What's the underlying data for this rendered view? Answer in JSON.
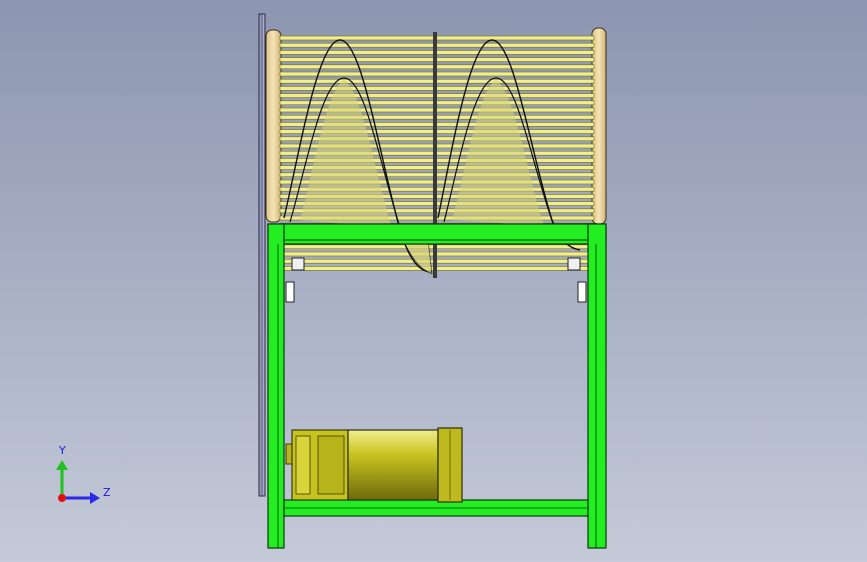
{
  "viewport": {
    "background_top": "#8c96b0",
    "background_bottom": "#c4cad8"
  },
  "model": {
    "frame_color": "#22ee22",
    "drum_color": "#f2ee8c",
    "motor_color": "#c8c41e",
    "flange_color": "#efd9a3",
    "side_plate_color": "#9fa3c6"
  },
  "triad": {
    "y_label": "Y",
    "z_label": "Z",
    "y_axis_color": "#22c022",
    "z_axis_color": "#2a2ae6",
    "origin_color": "#e01010",
    "icons": [
      "y-axis-arrow-icon",
      "z-axis-arrow-icon",
      "origin-dot-icon"
    ]
  }
}
